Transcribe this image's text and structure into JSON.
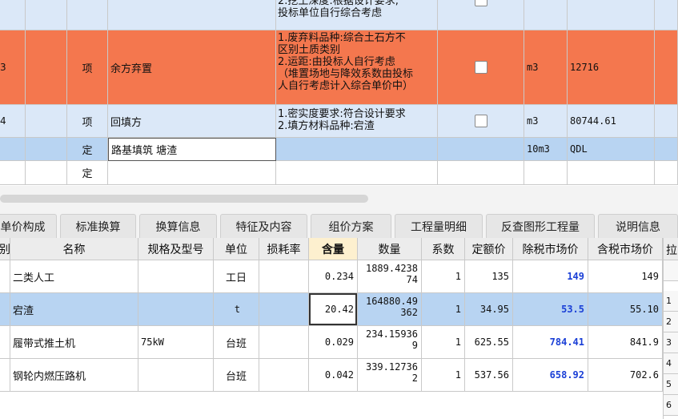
{
  "top_rows": [
    {
      "index": "",
      "type": "",
      "name": "",
      "features": "2.挖土深度:根据设计要求,\n投标单位自行综合考虑",
      "unit": "",
      "quantity": ""
    },
    {
      "index": "3",
      "type": "项",
      "name": "余方弃置",
      "features": "1.废弃料品种:综合土石方不\n区别土质类别\n2.运距:由投标人自行考虑\n（堆置场地与降效系数由投标\n人自行考虑计入综合单价中）",
      "unit": "m3",
      "quantity": "12716"
    },
    {
      "index": "4",
      "type": "项",
      "name": "回填方",
      "features": "1.密实度要求:符合设计要求\n2.填方材料品种:宕渣",
      "unit": "m3",
      "quantity": "80744.61"
    },
    {
      "index": "",
      "type": "定",
      "name": "路基填筑 塘渣",
      "features": "",
      "unit": "10m3",
      "quantity": "QDL"
    },
    {
      "index": "",
      "type": "定",
      "name": "",
      "features": "",
      "unit": "",
      "quantity": ""
    }
  ],
  "tabs": [
    "单价构成",
    "标准换算",
    "换算信息",
    "特征及内容",
    "组价方案",
    "工程量明细",
    "反查图形工程量",
    "说明信息"
  ],
  "table_headers": [
    "别",
    "名称",
    "规格及型号",
    "单位",
    "损耗率",
    "含量",
    "数量",
    "系数",
    "定额价",
    "除税市场价",
    "含税市场价"
  ],
  "side_header": "拉",
  "side_numbers": [
    "",
    "1",
    "2",
    "3",
    "4",
    "5",
    "6"
  ],
  "rows": [
    {
      "name": "二类人工",
      "spec": "",
      "unit": "工日",
      "loss": "",
      "content": "0.234",
      "quantity": "1889.4238\n74",
      "coef": "1",
      "quota": "135",
      "market_ex": "149",
      "market_inc": "149"
    },
    {
      "name": "宕渣",
      "spec": "",
      "unit": "t",
      "loss": "",
      "content": "20.42",
      "quantity": "164880.49\n362",
      "coef": "1",
      "quota": "34.95",
      "market_ex": "53.5",
      "market_inc": "55.10"
    },
    {
      "name": "履带式推土机",
      "spec": "75kW",
      "unit": "台班",
      "loss": "",
      "content": "0.029",
      "quantity": "234.15936\n9",
      "coef": "1",
      "quota": "625.55",
      "market_ex": "784.41",
      "market_inc": "841.9"
    },
    {
      "name": "钢轮内燃压路机",
      "spec": "",
      "unit": "台班",
      "loss": "",
      "content": "0.042",
      "quantity": "339.12736\n2",
      "coef": "1",
      "quota": "537.56",
      "market_ex": "658.92",
      "market_inc": "702.6"
    }
  ],
  "colors": {
    "orange_row": "#f4774e",
    "blue_row": "#dbe8f8",
    "selected_row": "#b8d4f2",
    "price_blue": "#1a3fd6"
  }
}
